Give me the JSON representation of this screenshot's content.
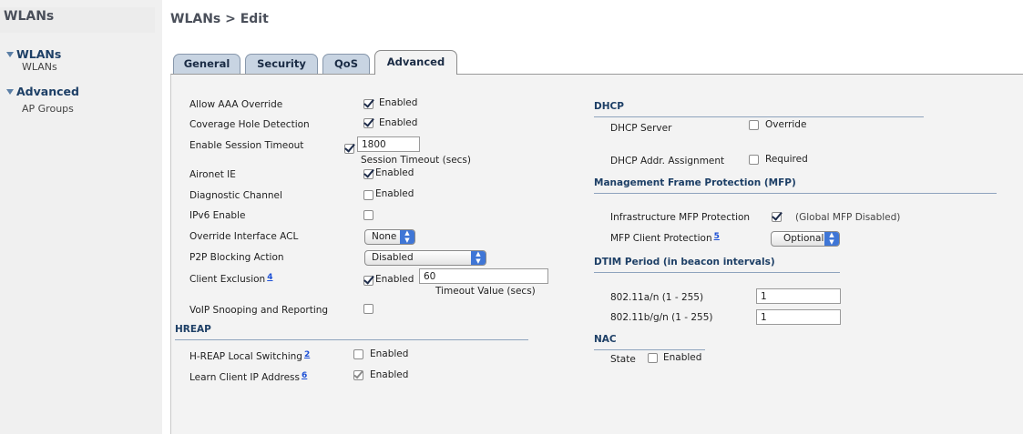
{
  "sidebar": {
    "title": "WLANs",
    "groups": [
      {
        "label": "WLANs",
        "items": [
          "WLANs"
        ]
      },
      {
        "label": "Advanced",
        "items": [
          "AP Groups"
        ]
      }
    ]
  },
  "header": {
    "title": "WLANs > Edit"
  },
  "tabs": [
    {
      "label": "General"
    },
    {
      "label": "Security"
    },
    {
      "label": "QoS"
    },
    {
      "label": "Advanced"
    }
  ],
  "left": {
    "allow_aaa_override": {
      "label": "Allow AAA Override",
      "checked": true,
      "value_label": "Enabled"
    },
    "coverage_hole": {
      "label": "Coverage Hole Detection",
      "checked": true,
      "value_label": "Enabled"
    },
    "session_timeout": {
      "label": "Enable Session Timeout",
      "checked": true,
      "value": "1800",
      "hint": "Session Timeout (secs)"
    },
    "aironet_ie": {
      "label": "Aironet IE",
      "checked": true,
      "value_label": "Enabled"
    },
    "diag_channel": {
      "label": "Diagnostic Channel",
      "checked": false,
      "value_label": "Enabled"
    },
    "ipv6_enable": {
      "label": "IPv6 Enable",
      "checked": false
    },
    "override_acl": {
      "label": "Override Interface ACL",
      "selected": "None"
    },
    "p2p_blocking": {
      "label": "P2P Blocking Action",
      "selected": "Disabled"
    },
    "client_exclusion": {
      "label": "Client Exclusion",
      "footnote": "4",
      "checked": true,
      "value_label": "Enabled",
      "value": "60",
      "hint": "Timeout Value (secs)"
    },
    "voip_snooping": {
      "label": "VoIP Snooping and Reporting",
      "checked": false
    }
  },
  "hreap": {
    "title": "HREAP",
    "local_switching": {
      "label": "H-REAP Local Switching",
      "footnote": "2",
      "checked": false,
      "value_label": "Enabled"
    },
    "learn_client_ip": {
      "label": "Learn Client IP Address",
      "footnote": "6",
      "checked": true,
      "value_label": "Enabled"
    }
  },
  "dhcp": {
    "title": "DHCP",
    "server": {
      "label": "DHCP Server",
      "checked": false,
      "value_label": "Override"
    },
    "addr_assignment": {
      "label": "DHCP Addr. Assignment",
      "checked": false,
      "value_label": "Required"
    }
  },
  "mfp": {
    "title": "Management Frame Protection (MFP)",
    "infrastructure": {
      "label": "Infrastructure MFP Protection",
      "checked": true,
      "note": "(Global MFP Disabled)"
    },
    "client": {
      "label": "MFP Client Protection",
      "footnote": "5",
      "selected": "Optional"
    }
  },
  "dtim": {
    "title": "DTIM Period (in beacon intervals)",
    "a_n": {
      "label": "802.11a/n (1 - 255)",
      "value": "1"
    },
    "b_g_n": {
      "label": "802.11b/g/n (1 - 255)",
      "value": "1"
    }
  },
  "nac": {
    "title": "NAC",
    "state": {
      "label": "State",
      "checked": false,
      "value_label": "Enabled"
    }
  }
}
